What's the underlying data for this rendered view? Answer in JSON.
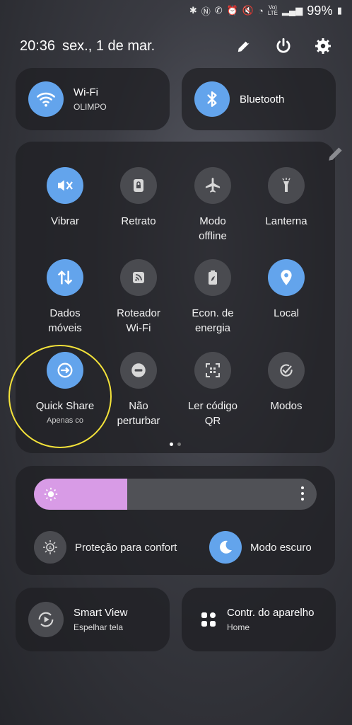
{
  "status_bar": {
    "battery": "99%"
  },
  "header": {
    "time": "20:36",
    "date": "sex., 1 de mar."
  },
  "top_tiles": [
    {
      "name": "Wi-Fi",
      "sub": "OLIMPO"
    },
    {
      "name": "Bluetooth"
    }
  ],
  "quick_settings": [
    {
      "label": "Vibrar"
    },
    {
      "label": "Retrato"
    },
    {
      "label": "Modo offline"
    },
    {
      "label": "Lanterna"
    },
    {
      "label": "Dados móveis"
    },
    {
      "label": "Roteador Wi-Fi"
    },
    {
      "label": "Econ. de energia"
    },
    {
      "label": "Local"
    },
    {
      "label": "Quick Share",
      "sub": "Apenas co"
    },
    {
      "label": "Não perturbar"
    },
    {
      "label": "Ler código QR"
    },
    {
      "label": "Modos"
    }
  ],
  "brightness": {
    "level": 0.33
  },
  "brightness_row": {
    "comfort": "Proteção para confort",
    "dark_mode": "Modo escuro"
  },
  "bottom_tiles": [
    {
      "name": "Smart View",
      "sub": "Espelhar tela"
    },
    {
      "name": "Contr. do aparelho",
      "sub": "Home"
    }
  ],
  "colors": {
    "accent": "#63a4ec",
    "brightness_fill": "#d89be6",
    "highlight": "#f4e33a"
  }
}
